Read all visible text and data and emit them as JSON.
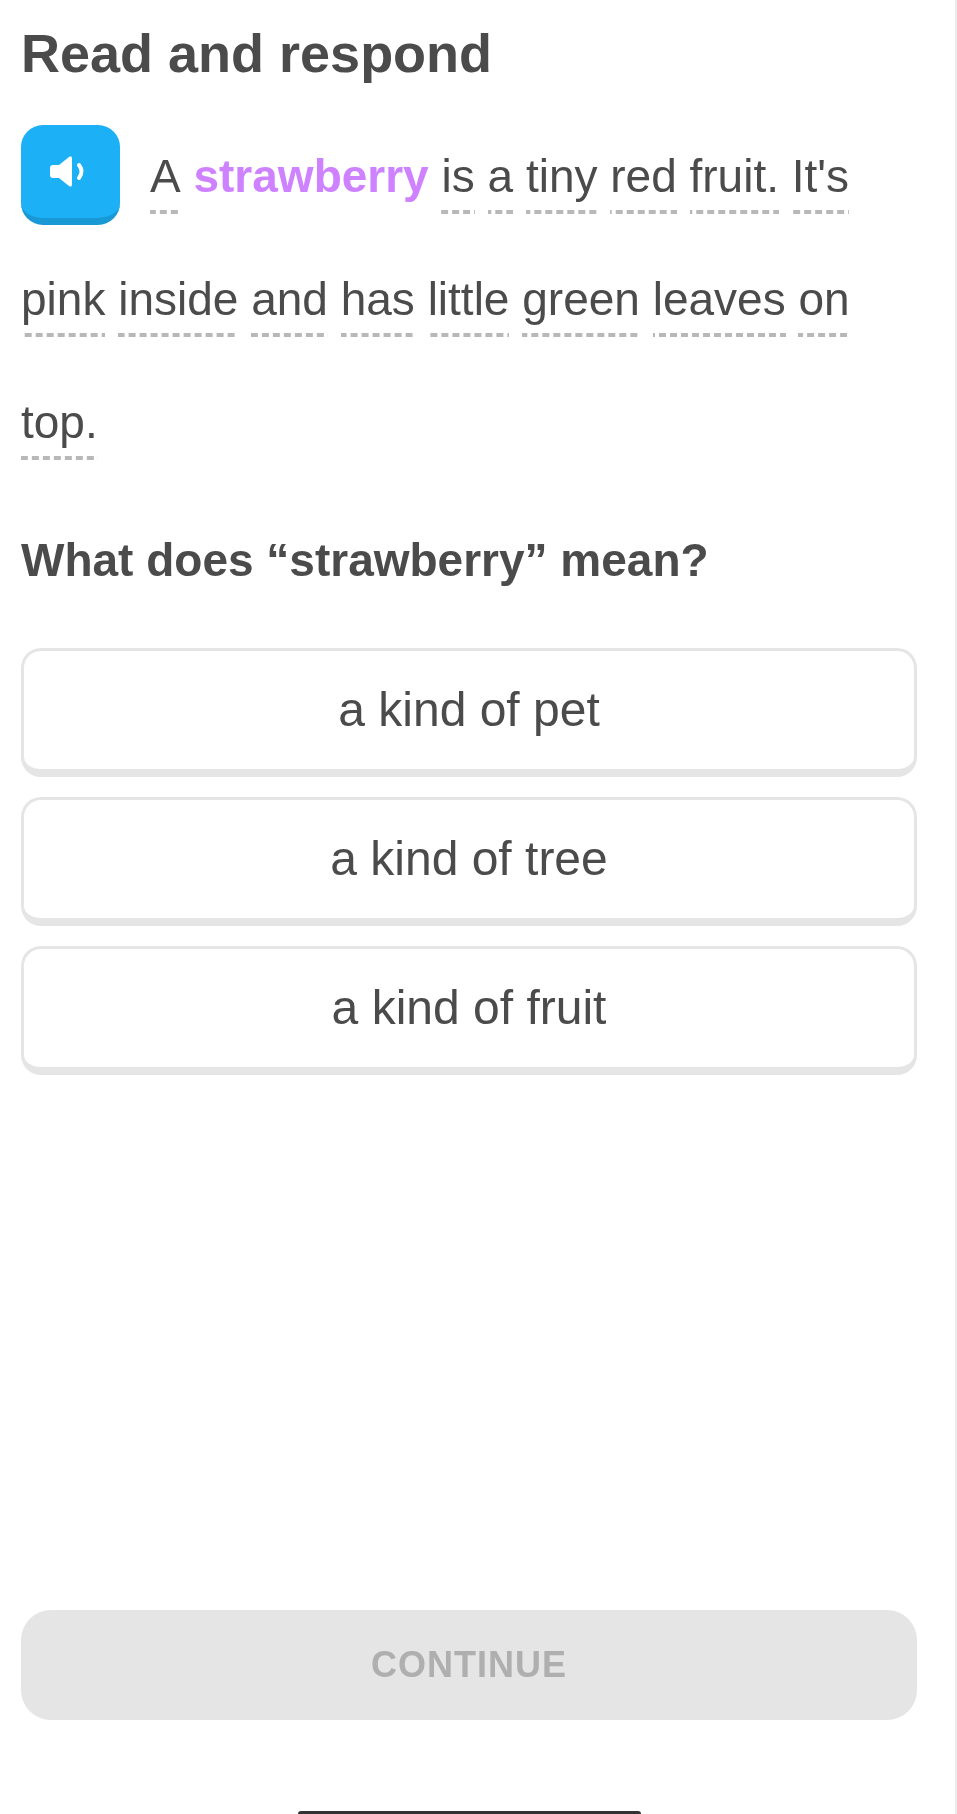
{
  "header": {
    "title": "Read and respond"
  },
  "passage": {
    "tokens": [
      {
        "text": "A",
        "kind": "hint"
      },
      {
        "text": "strawberry",
        "kind": "highlight"
      },
      {
        "text": "is",
        "kind": "hint"
      },
      {
        "text": "a",
        "kind": "hint"
      },
      {
        "text": "tiny",
        "kind": "hint"
      },
      {
        "text": "red",
        "kind": "hint"
      },
      {
        "text": "fruit.",
        "kind": "hint"
      },
      {
        "text": "It's",
        "kind": "hint"
      },
      {
        "text": "pink",
        "kind": "hint"
      },
      {
        "text": "inside",
        "kind": "hint"
      },
      {
        "text": "and",
        "kind": "hint"
      },
      {
        "text": "has",
        "kind": "hint"
      },
      {
        "text": "little",
        "kind": "hint"
      },
      {
        "text": "green",
        "kind": "hint"
      },
      {
        "text": "leaves",
        "kind": "hint"
      },
      {
        "text": "on",
        "kind": "hint"
      },
      {
        "text": "top.",
        "kind": "hint"
      }
    ]
  },
  "question": {
    "text": "What does “strawberry” mean?"
  },
  "choices": [
    {
      "label": "a kind of pet",
      "selected": false
    },
    {
      "label": "a kind of tree",
      "selected": false
    },
    {
      "label": "a kind of fruit",
      "selected": false
    }
  ],
  "continue_button": {
    "label": "CONTINUE",
    "disabled": true
  }
}
